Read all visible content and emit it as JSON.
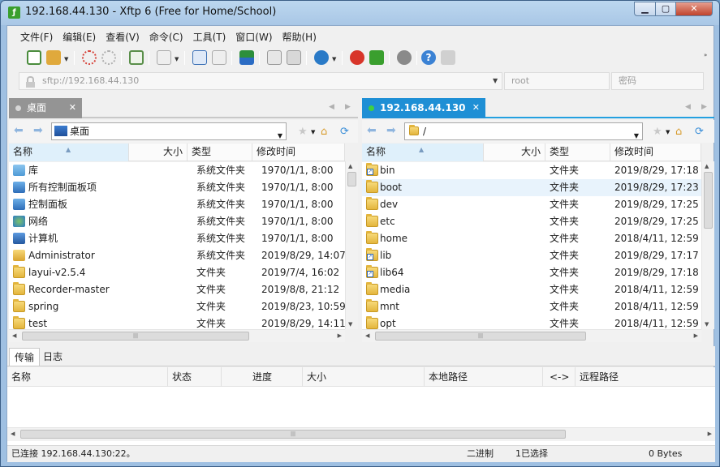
{
  "window": {
    "title": "192.168.44.130 - Xftp 6 (Free for Home/School)",
    "app_icon": "xftp-icon",
    "controls": {
      "minimize": "▁",
      "maximize": "▢",
      "close": "✕"
    }
  },
  "menu": [
    "文件(F)",
    "编辑(E)",
    "查看(V)",
    "命令(C)",
    "工具(T)",
    "窗口(W)",
    "帮助(H)"
  ],
  "toolbar": {
    "icons": [
      "new-session-icon",
      "open-folder-icon",
      "disconnect-icon",
      "reconnect-icon",
      "session-properties-icon",
      "terminal-icon",
      "upload-icon",
      "download-icon",
      "transfer-icon",
      "copy-icon",
      "paste-icon",
      "globe-icon",
      "xshell-icon",
      "xftp-icon",
      "settings-icon",
      "help-icon",
      "chat-icon"
    ]
  },
  "address": {
    "url_placeholder": "sftp://192.168.44.130",
    "user_placeholder": "root",
    "password_placeholder": "密码"
  },
  "left_panel": {
    "tab_label": "桌面",
    "path": "桌面",
    "columns": [
      "名称",
      "大小",
      "类型",
      "修改时间"
    ],
    "rows": [
      {
        "name": "库",
        "size": "",
        "type": "系统文件夹",
        "modified": "1970/1/1, 8:00",
        "icon": "library-icon"
      },
      {
        "name": "所有控制面板项",
        "size": "",
        "type": "系统文件夹",
        "modified": "1970/1/1, 8:00",
        "icon": "control-panel-items-icon"
      },
      {
        "name": "控制面板",
        "size": "",
        "type": "系统文件夹",
        "modified": "1970/1/1, 8:00",
        "icon": "control-panel-icon"
      },
      {
        "name": "网络",
        "size": "",
        "type": "系统文件夹",
        "modified": "1970/1/1, 8:00",
        "icon": "network-icon"
      },
      {
        "name": "计算机",
        "size": "",
        "type": "系统文件夹",
        "modified": "1970/1/1, 8:00",
        "icon": "computer-icon"
      },
      {
        "name": "Administrator",
        "size": "",
        "type": "系统文件夹",
        "modified": "2019/8/29, 14:07",
        "icon": "user-folder-icon"
      },
      {
        "name": "layui-v2.5.4",
        "size": "",
        "type": "文件夹",
        "modified": "2019/7/4, 16:02",
        "icon": "folder-icon"
      },
      {
        "name": "Recorder-master",
        "size": "",
        "type": "文件夹",
        "modified": "2019/8/8, 21:12",
        "icon": "folder-icon"
      },
      {
        "name": "spring",
        "size": "",
        "type": "文件夹",
        "modified": "2019/8/23, 10:59",
        "icon": "folder-icon"
      },
      {
        "name": "test",
        "size": "",
        "type": "文件夹",
        "modified": "2019/8/29, 14:11",
        "icon": "folder-icon"
      }
    ]
  },
  "right_panel": {
    "tab_label": "192.168.44.130",
    "path": "/",
    "columns": [
      "名称",
      "大小",
      "类型",
      "修改时间"
    ],
    "rows": [
      {
        "name": "bin",
        "size": "",
        "type": "文件夹",
        "modified": "2019/8/29, 17:18",
        "link": true
      },
      {
        "name": "boot",
        "size": "",
        "type": "文件夹",
        "modified": "2019/8/29, 17:23",
        "link": false
      },
      {
        "name": "dev",
        "size": "",
        "type": "文件夹",
        "modified": "2019/8/29, 17:25",
        "link": false
      },
      {
        "name": "etc",
        "size": "",
        "type": "文件夹",
        "modified": "2019/8/29, 17:25",
        "link": false
      },
      {
        "name": "home",
        "size": "",
        "type": "文件夹",
        "modified": "2018/4/11, 12:59",
        "link": false
      },
      {
        "name": "lib",
        "size": "",
        "type": "文件夹",
        "modified": "2019/8/29, 17:17",
        "link": true
      },
      {
        "name": "lib64",
        "size": "",
        "type": "文件夹",
        "modified": "2019/8/29, 17:18",
        "link": true
      },
      {
        "name": "media",
        "size": "",
        "type": "文件夹",
        "modified": "2018/4/11, 12:59",
        "link": false
      },
      {
        "name": "mnt",
        "size": "",
        "type": "文件夹",
        "modified": "2018/4/11, 12:59",
        "link": false
      },
      {
        "name": "opt",
        "size": "",
        "type": "文件夹",
        "modified": "2018/4/11, 12:59",
        "link": false
      }
    ],
    "highlighted_row": 1
  },
  "bottom": {
    "tabs": [
      "传输",
      "日志"
    ],
    "columns": [
      "名称",
      "状态",
      "进度",
      "大小",
      "本地路径",
      "<->",
      "远程路径"
    ]
  },
  "status": {
    "connection": "已连接 192.168.44.130:22。",
    "mode": "二进制",
    "selection": "1已选择",
    "size": "0 Bytes"
  }
}
